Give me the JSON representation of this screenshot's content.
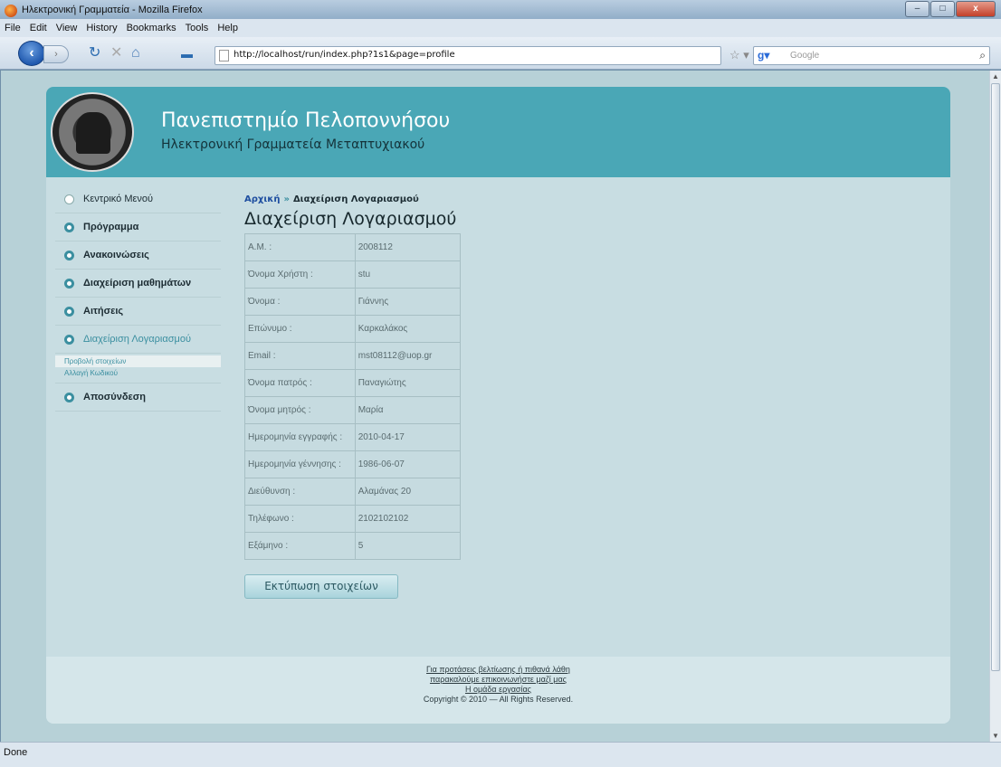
{
  "window": {
    "title": "Ηλεκτρονική Γραμματεία - Mozilla Firefox",
    "min": "–",
    "max": "□",
    "close": "x"
  },
  "menu": [
    "File",
    "Edit",
    "View",
    "History",
    "Bookmarks",
    "Tools",
    "Help"
  ],
  "nav": {
    "url": "http://localhost/run/index.php?1s1&page=profile",
    "search_placeholder": "Google"
  },
  "site": {
    "title": "Πανεπιστημίο Πελοποννήσου",
    "subtitle": "Ηλεκτρονική Γραμματεία Μεταπτυχιακού"
  },
  "sidebar": {
    "items": [
      "Κεντρικό Μενού",
      "Πρόγραμμα",
      "Ανακοινώσεις",
      "Διαχείριση μαθημάτων",
      "Αιτήσεις",
      "Διαχείριση Λογαριασμού",
      "Αποσύνδεση"
    ],
    "subitems": [
      "Προβολή στοιχείων",
      "Αλλαγή Κωδικού"
    ]
  },
  "breadcrumb": {
    "home": "Αρχική",
    "sep": "»",
    "current": "Διαχείριση Λογαριασμού"
  },
  "heading": "Διαχείριση Λογαριασμού",
  "profile": [
    {
      "label": "Α.Μ. :",
      "value": "2008112"
    },
    {
      "label": "Όνομα Χρήστη :",
      "value": "stu"
    },
    {
      "label": "Όνομα :",
      "value": "Γιάννης"
    },
    {
      "label": "Επώνυμο :",
      "value": "Καρκαλάκος"
    },
    {
      "label": "Email :",
      "value": "mst08112@uop.gr"
    },
    {
      "label": "Όνομα πατρός :",
      "value": "Παναγιώτης"
    },
    {
      "label": "Όνομα μητρός :",
      "value": "Μαρία"
    },
    {
      "label": "Ημερομηνία εγγραφής :",
      "value": "2010-04-17"
    },
    {
      "label": "Ημερομηνία γέννησης :",
      "value": "1986-06-07"
    },
    {
      "label": "Διεύθυνση :",
      "value": "Αλαμάνας 20"
    },
    {
      "label": "Τηλέφωνο :",
      "value": "2102102102"
    },
    {
      "label": "Εξάμηνο :",
      "value": "5"
    }
  ],
  "print_button": "Εκτύπωση στοιχείων",
  "footer": {
    "line1": "Για προτάσεις βελτίωσης ή πιθανά λάθη",
    "line2": "παρακαλούμε επικοινωνήστε μαζί μας",
    "line3": "Η ομάδα εργασίας",
    "copyright": "Copyright © 2010 — All Rights Reserved."
  },
  "status": "Done"
}
